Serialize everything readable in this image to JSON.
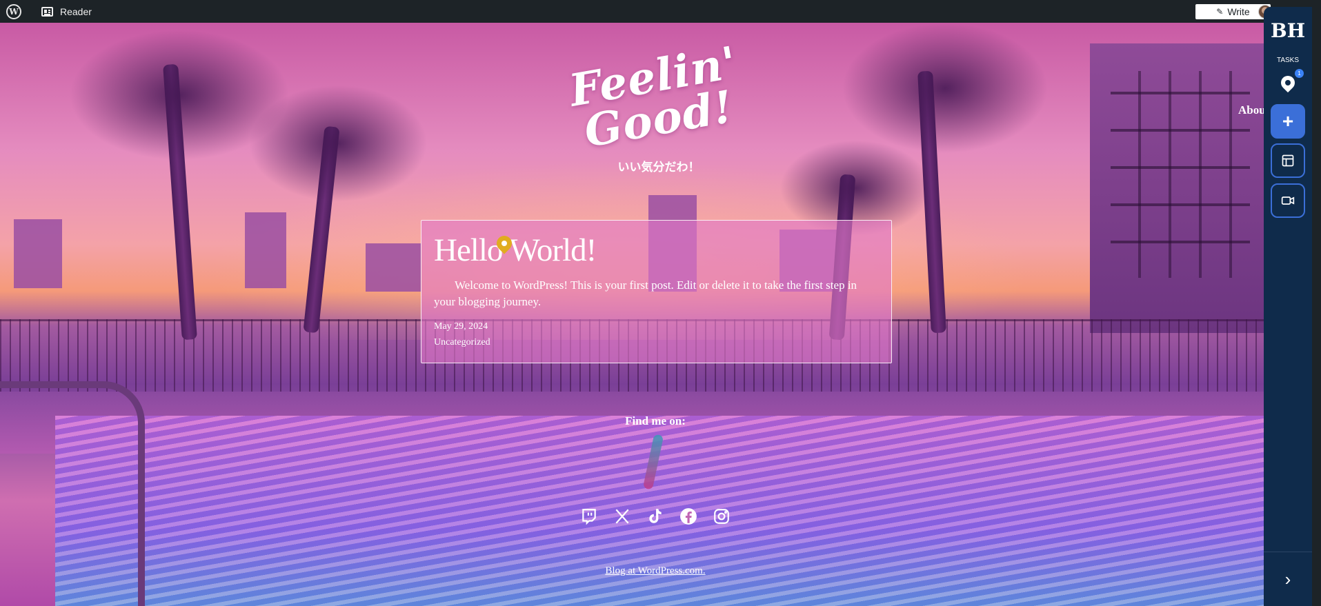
{
  "adminbar": {
    "reader_label": "Reader",
    "write_label": "Write"
  },
  "site": {
    "title_line1": "Feelin'",
    "title_line2": "Good!",
    "tagline": "いい気分だわ！",
    "nav_about": "Abou"
  },
  "post": {
    "title": "Hello World!",
    "excerpt": "Welcome to WordPress! This is your first post. Edit or delete it to take the first step in your blogging journey.",
    "date": "May 29, 2024",
    "category": "Uncategorized"
  },
  "footer": {
    "find_me": "Find me on:",
    "social": [
      "twitch-icon",
      "x-icon",
      "tiktok-icon",
      "facebook-icon",
      "instagram-icon"
    ],
    "credit": "Blog at WordPress.com."
  },
  "sidebar": {
    "logo": "BH",
    "tasks_label": "TASKS",
    "badge_count": "1"
  },
  "colors": {
    "adminbar_bg": "#1d2327",
    "sidebar_bg": "#0f2b4b",
    "accent_blue": "#3b6fd8",
    "pin_yellow": "#e1ac1f"
  }
}
